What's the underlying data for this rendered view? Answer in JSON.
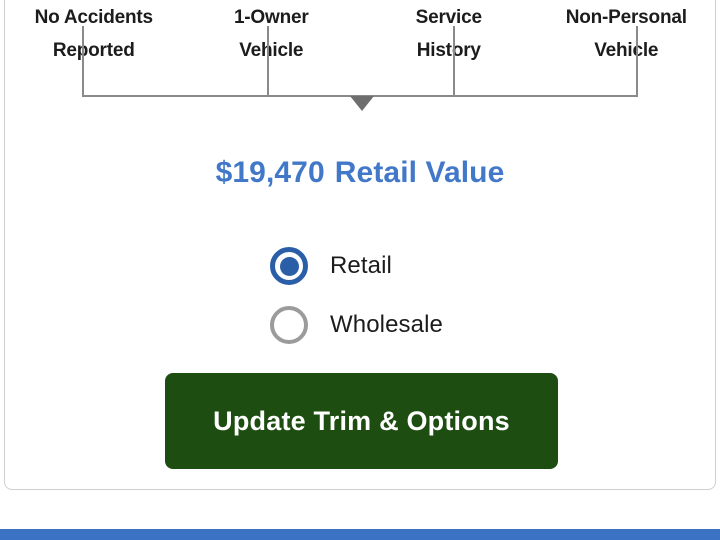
{
  "card": {
    "highlights": [
      {
        "line1": "No Accidents",
        "line2": "Reported"
      },
      {
        "line1": "1-Owner",
        "line2": "Vehicle"
      },
      {
        "line1": "Service",
        "line2": "History"
      },
      {
        "line1": "Non-Personal",
        "line2": "Vehicle"
      }
    ],
    "scale": {
      "marker_label": "condition-marker",
      "line_color": "#8a8a8a",
      "marker_color": "#6e6e6e"
    },
    "value": {
      "amount": "$19,470",
      "label": "Retail Value",
      "color": "#4178c8"
    },
    "price_type": {
      "options": [
        {
          "label": "Retail",
          "selected": true
        },
        {
          "label": "Wholesale",
          "selected": false
        }
      ],
      "selected_color": "#2a5fa8",
      "unselected_color": "#9b9b9b"
    },
    "cta": {
      "label": "Update Trim & Options",
      "background": "#1e4d12",
      "text_color": "#ffffff"
    }
  },
  "bottom_bar": {
    "color": "#3b72c4"
  }
}
